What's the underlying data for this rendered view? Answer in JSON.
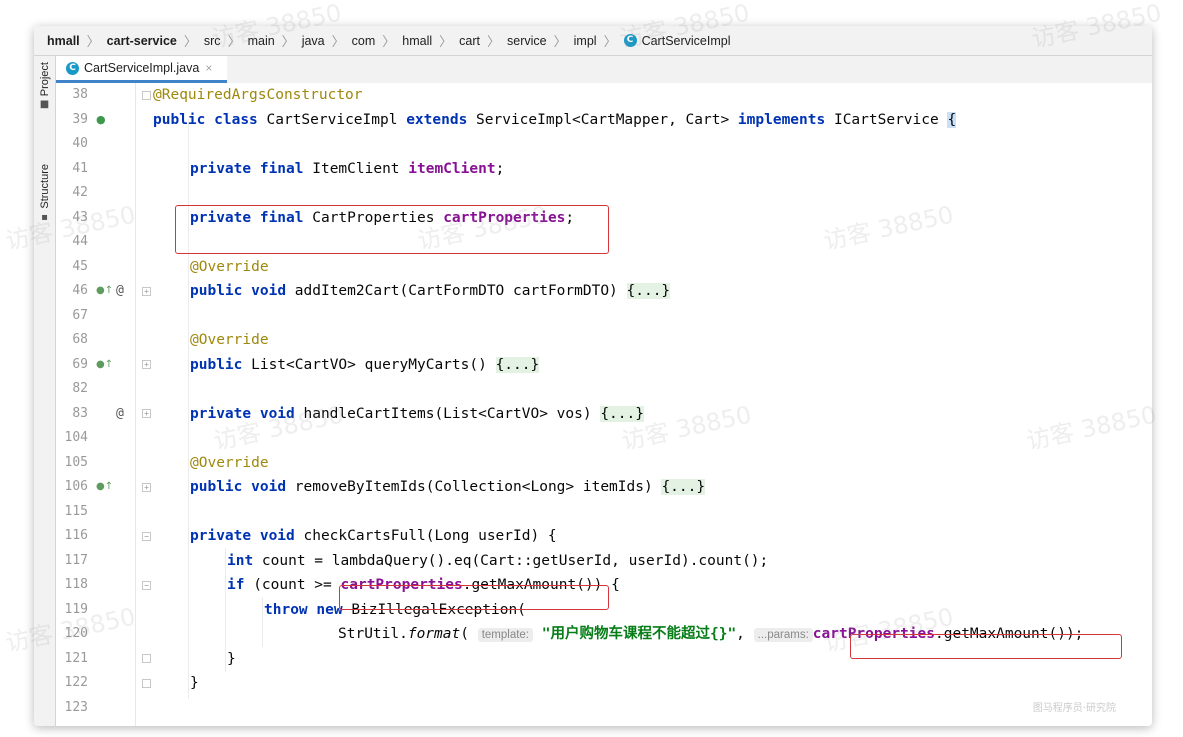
{
  "breadcrumb": [
    "hmall",
    "cart-service",
    "src",
    "main",
    "java",
    "com",
    "hmall",
    "cart",
    "service",
    "impl",
    "CartServiceImpl"
  ],
  "tab": {
    "label": "CartServiceImpl.java",
    "close": "×"
  },
  "side_tabs": {
    "project": "Project",
    "structure": "Structure"
  },
  "line_numbers": [
    "38",
    "39",
    "40",
    "41",
    "42",
    "43",
    "44",
    "45",
    "46",
    "67",
    "68",
    "69",
    "82",
    "83",
    "104",
    "105",
    "106",
    "115",
    "116",
    "117",
    "118",
    "119",
    "120",
    "121",
    "122",
    "123"
  ],
  "code": {
    "l38_ann": "@RequiredArgsConstructor",
    "l39_public": "public",
    "l39_class": "class",
    "l39_name": " CartServiceImpl ",
    "l39_extends": "extends",
    "l39_base": " ServiceImpl<CartMapper, Cart> ",
    "l39_implements": "implements",
    "l39_iface": " ICartService ",
    "l39_brace": "{",
    "l41_private": "private",
    "l41_final": "final",
    "l41_type": " ItemClient ",
    "l41_field": "itemClient",
    "l41_semi": ";",
    "l43_private": "private",
    "l43_final": "final",
    "l43_type": " CartProperties ",
    "l43_field": "cartProperties",
    "l43_semi": ";",
    "l45_ann": "@Override",
    "l46_public": "public",
    "l46_void": "void",
    "l46_sig": " addItem2Cart(CartFormDTO cartFormDTO) ",
    "l46_fold": "{...}",
    "l68_ann": "@Override",
    "l69_public": "public",
    "l69_sig": " List<CartVO> queryMyCarts() ",
    "l69_fold": "{...}",
    "l83_private": "private",
    "l83_void": "void",
    "l83_sig": " handleCartItems(List<CartVO> vos) ",
    "l83_fold": "{...}",
    "l105_ann": "@Override",
    "l106_public": "public",
    "l106_void": "void",
    "l106_sig": " removeByItemIds(Collection<Long> itemIds) ",
    "l106_fold": "{...}",
    "l116_private": "private",
    "l116_void": "void",
    "l116_sig": " checkCartsFull(Long userId) {",
    "l117_int": "int",
    "l117_rest": " count = lambdaQuery().eq(Cart::getUserId, userId).count();",
    "l118_if": "if",
    "l118_pre": " (count >= ",
    "l118_field": "cartProperties",
    "l118_call": ".getMaxAmount()",
    "l118_post": ") {",
    "l119_throw": "throw",
    "l119_new": "new",
    "l119_rest": " BizIllegalException(",
    "l120_pre": "StrUtil.",
    "l120_fmt": "format",
    "l120_paren": "( ",
    "l120_hint1": "template:",
    "l120_str": "\"用户购物车课程不能超过{}\"",
    "l120_comma": ", ",
    "l120_hint2": "...params:",
    "l120_field": "cartProperties",
    "l120_call": ".getMaxAmount()",
    "l120_post": ");",
    "l121": "}",
    "l122": "}"
  },
  "watermark": "访客 38850",
  "signature": "图马程序员·研究院"
}
